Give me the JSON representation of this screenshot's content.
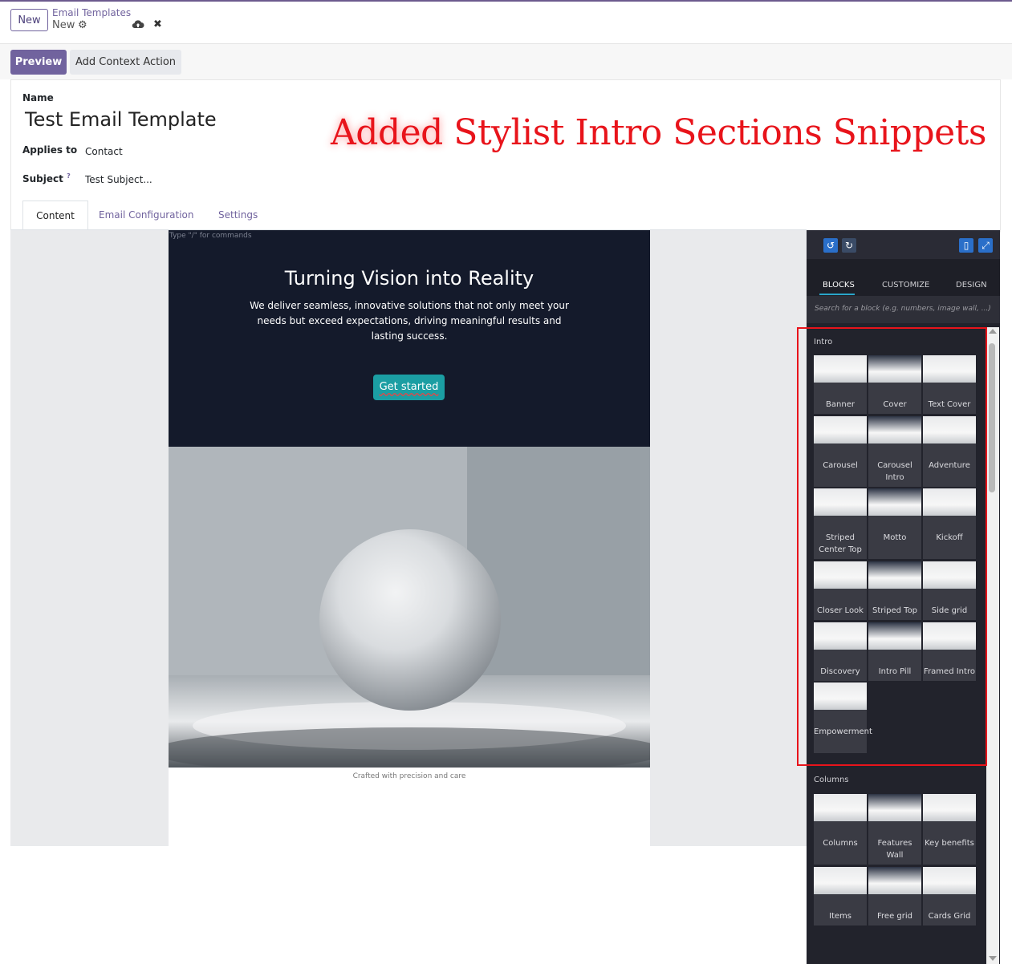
{
  "control_panel": {
    "new_label": "New",
    "breadcrumb_parent": "Email Templates",
    "breadcrumb_current": "New"
  },
  "buttons": {
    "preview": "Preview",
    "add_context_action": "Add Context Action"
  },
  "form": {
    "name_label": "Name",
    "name_value": "Test Email Template",
    "applies_to_label": "Applies to",
    "applies_to_value": "Contact",
    "subject_label": "Subject",
    "subject_help": "?",
    "subject_value": "Test Subject..."
  },
  "annotation": {
    "word1": "Added",
    "rest": " Stylist Intro Sections Snippets",
    "color": "#e8141b"
  },
  "tabs": [
    "Content",
    "Email Configuration",
    "Settings"
  ],
  "editor": {
    "hint": "Type \"/\" for commands",
    "hero_title": "Turning Vision into Reality",
    "hero_text": "We deliver seamless, innovative solutions that not only meet your needs but exceed expectations, driving meaningful results and lasting success.",
    "hero_button": "Get started",
    "footer": "Crafted with precision and care"
  },
  "panel": {
    "tabs": [
      "BLOCKS",
      "CUSTOMIZE",
      "DESIGN"
    ],
    "search_placeholder": "Search for a block (e.g. numbers, image wall, ...)",
    "intro_title": "Intro",
    "intro_blocks": [
      "Banner",
      "Cover",
      "Text Cover",
      "Carousel",
      "Carousel Intro",
      "Adventure",
      "Striped Center Top",
      "Motto",
      "Kickoff",
      "Closer Look",
      "Striped Top",
      "Side grid",
      "Discovery",
      "Intro Pill",
      "Framed Intro",
      "Empowerment"
    ],
    "columns_title": "Columns",
    "columns_blocks": [
      "Columns",
      "Features Wall",
      "Key benefits",
      "Items",
      "Free grid",
      "Cards Grid"
    ],
    "accent": "#2a6fc9"
  }
}
